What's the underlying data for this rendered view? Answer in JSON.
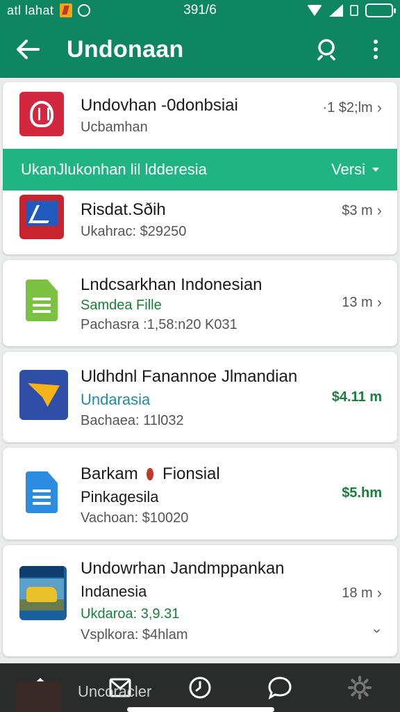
{
  "status_bar": {
    "carrier": "atl lahat",
    "time": "391/6"
  },
  "app_bar": {
    "title": "Undonaan",
    "back_icon": "arrow-left-icon",
    "search_icon": "search-icon",
    "more_icon": "more-vertical-icon"
  },
  "banner": {
    "text": "UkanJlukonhan lil ldderesia",
    "right_label": "Versi"
  },
  "items": [
    {
      "title": "Undovhan -0donbsiai",
      "line1": "Ucbamhan",
      "line2": "",
      "right": "·1 $2;lm",
      "icon": "red-emblem-icon"
    },
    {
      "title": "Risdat.Sðih",
      "line1": "Ukahrac: $29250",
      "line2": "",
      "right": "$3 m",
      "icon": "chart-app-icon"
    },
    {
      "title": "Lndcsarkhan Indonesian",
      "line1": "Samdea Fille",
      "line2": "Pachasra :1,58:n20 K031",
      "right": "13 m",
      "icon": "green-document-icon"
    },
    {
      "title": "Uldhdnl Fanannoe Jlmandian",
      "line1": "Undarasia",
      "line2": "Bachaea: 11l032",
      "right": "$4.11 m",
      "icon": "paper-plane-icon"
    },
    {
      "title": "Barkam",
      "title_suffix": "Fionsial",
      "line1": "Pinkagesila",
      "line2": "Vachoan: $10020",
      "right": "$5.hm",
      "icon": "blue-document-icon"
    },
    {
      "title": "Undowrhan Jandmppankan",
      "line1": "Indanesia",
      "line2": "Ukdaroa: 3,9.31",
      "line3": "Vsplkora: $4hlam",
      "right": "18 m",
      "icon": "car-photo-icon"
    }
  ],
  "peek_item": {
    "title": "Uncoracler"
  },
  "bottom_nav": [
    {
      "name": "home",
      "icon": "home-icon"
    },
    {
      "name": "inbox",
      "icon": "mail-icon"
    },
    {
      "name": "history",
      "icon": "clock-icon"
    },
    {
      "name": "chat",
      "icon": "chat-bubble-icon"
    },
    {
      "name": "settings",
      "icon": "gear-icon"
    }
  ],
  "colors": {
    "primary": "#0e8661",
    "banner": "#20b482",
    "nav_bg": "#2a2c2c",
    "green_text": "#17803a",
    "teal_text": "#1e8ca6"
  }
}
